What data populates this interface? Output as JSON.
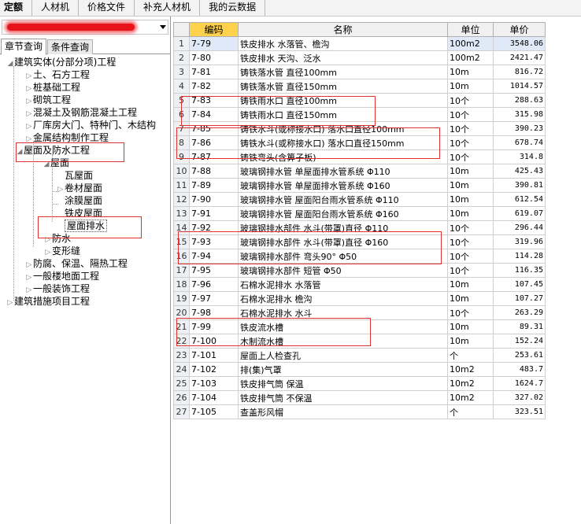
{
  "topmenu": [
    "定额",
    "人材机",
    "价格文件",
    "补充人材机",
    "我的云数据"
  ],
  "left": {
    "tabs": [
      "章节查询",
      "条件查询"
    ],
    "tree": [
      {
        "label": "建筑实体(分部分项)工程",
        "toggle": "◢"
      },
      {
        "label": "土、石方工程",
        "toggle": "▷"
      },
      {
        "label": "桩基础工程",
        "toggle": "▷"
      },
      {
        "label": "砌筑工程",
        "toggle": "▷"
      },
      {
        "label": "混凝土及钢筋混凝土工程",
        "toggle": "▷"
      },
      {
        "label": "厂库房大门、特种门、木结构",
        "toggle": "▷"
      },
      {
        "label": "金属结构制作工程",
        "toggle": "▷"
      },
      {
        "label": "屋面及防水工程",
        "toggle": "◢"
      },
      {
        "label": "屋面",
        "toggle": "◢"
      },
      {
        "label": "瓦屋面",
        "toggle": ""
      },
      {
        "label": "卷材屋面",
        "toggle": "▷"
      },
      {
        "label": "涂膜屋面",
        "toggle": ""
      },
      {
        "label": "铁皮屋面",
        "toggle": ""
      },
      {
        "label": "屋面排水",
        "toggle": ""
      },
      {
        "label": "防水",
        "toggle": "▷"
      },
      {
        "label": "变形缝",
        "toggle": "▷"
      },
      {
        "label": "防腐、保温、隔热工程",
        "toggle": "▷"
      },
      {
        "label": "一般楼地面工程",
        "toggle": "▷"
      },
      {
        "label": "一般装饰工程",
        "toggle": "▷"
      },
      {
        "label": "建筑措施项目工程",
        "toggle": "▷"
      }
    ]
  },
  "table": {
    "columns": [
      "编码",
      "名称",
      "单位",
      "单价"
    ],
    "rows": [
      {
        "num": "1",
        "code": "7-79",
        "name": "铁皮排水 水落管、檐沟",
        "unit": "100m2",
        "price": "3548.06"
      },
      {
        "num": "2",
        "code": "7-80",
        "name": "铁皮排水 天沟、泛水",
        "unit": "100m2",
        "price": "2421.47"
      },
      {
        "num": "3",
        "code": "7-81",
        "name": "铸铁落水管 直径100mm",
        "unit": "10m",
        "price": "816.72"
      },
      {
        "num": "4",
        "code": "7-82",
        "name": "铸铁落水管 直径150mm",
        "unit": "10m",
        "price": "1014.57"
      },
      {
        "num": "5",
        "code": "7-83",
        "name": "铸铁雨水口 直径100mm",
        "unit": "10个",
        "price": "288.63"
      },
      {
        "num": "6",
        "code": "7-84",
        "name": "铸铁雨水口 直径150mm",
        "unit": "10个",
        "price": "315.98"
      },
      {
        "num": "7",
        "code": "7-85",
        "name": "铸铁水斗(或称接水口) 落水口直径100mm",
        "unit": "10个",
        "price": "390.23"
      },
      {
        "num": "8",
        "code": "7-86",
        "name": "铸铁水斗(或称接水口) 落水口直径150mm",
        "unit": "10个",
        "price": "678.74"
      },
      {
        "num": "9",
        "code": "7-87",
        "name": "铸铁弯头(含箅子板)",
        "unit": "10个",
        "price": "314.8"
      },
      {
        "num": "10",
        "code": "7-88",
        "name": "玻璃钢排水管 单屋面排水管系统 Φ110",
        "unit": "10m",
        "price": "425.43"
      },
      {
        "num": "11",
        "code": "7-89",
        "name": "玻璃钢排水管 单屋面排水管系统 Φ160",
        "unit": "10m",
        "price": "390.81"
      },
      {
        "num": "12",
        "code": "7-90",
        "name": "玻璃钢排水管 屋面阳台雨水管系统 Φ110",
        "unit": "10m",
        "price": "612.54"
      },
      {
        "num": "13",
        "code": "7-91",
        "name": "玻璃钢排水管 屋面阳台雨水管系统 Φ160",
        "unit": "10m",
        "price": "619.07"
      },
      {
        "num": "14",
        "code": "7-92",
        "name": "玻璃钢排水部件 水斗(带罩)直径 Φ110",
        "unit": "10个",
        "price": "296.44"
      },
      {
        "num": "15",
        "code": "7-93",
        "name": "玻璃钢排水部件 水斗(带罩)直径 Φ160",
        "unit": "10个",
        "price": "319.96"
      },
      {
        "num": "16",
        "code": "7-94",
        "name": "玻璃钢排水部件 弯头90° Φ50",
        "unit": "10个",
        "price": "114.28"
      },
      {
        "num": "17",
        "code": "7-95",
        "name": "玻璃钢排水部件 短管 Φ50",
        "unit": "10个",
        "price": "116.35"
      },
      {
        "num": "18",
        "code": "7-96",
        "name": "石棉水泥排水 水落管",
        "unit": "10m",
        "price": "107.45"
      },
      {
        "num": "19",
        "code": "7-97",
        "name": "石棉水泥排水 檐沟",
        "unit": "10m",
        "price": "107.27"
      },
      {
        "num": "20",
        "code": "7-98",
        "name": "石棉水泥排水 水斗",
        "unit": "10个",
        "price": "263.29"
      },
      {
        "num": "21",
        "code": "7-99",
        "name": "铁皮流水槽",
        "unit": "10m",
        "price": "89.31"
      },
      {
        "num": "22",
        "code": "7-100",
        "name": "木制流水槽",
        "unit": "10m",
        "price": "152.24"
      },
      {
        "num": "23",
        "code": "7-101",
        "name": "屋面上人检查孔",
        "unit": "个",
        "price": "253.61"
      },
      {
        "num": "24",
        "code": "7-102",
        "name": "排(集)气罩",
        "unit": "10m2",
        "price": "483.7"
      },
      {
        "num": "25",
        "code": "7-103",
        "name": "铁皮排气筒 保温",
        "unit": "10m2",
        "price": "1624.7"
      },
      {
        "num": "26",
        "code": "7-104",
        "name": "铁皮排气筒 不保温",
        "unit": "10m2",
        "price": "327.02"
      },
      {
        "num": "27",
        "code": "7-105",
        "name": "查盖形风帽",
        "unit": "个",
        "price": "323.51"
      }
    ]
  },
  "colors": {
    "header_code": "#ffd24d",
    "selection": "#dfe9f7",
    "annotation": "#e0332f"
  }
}
